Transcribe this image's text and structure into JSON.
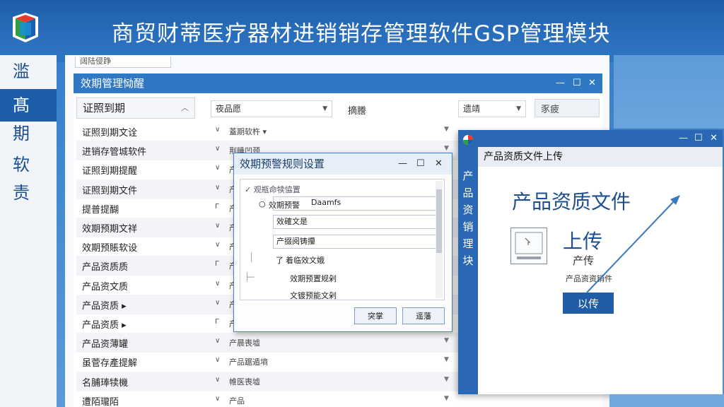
{
  "banner": {
    "title": "商贸财蒂医疗器材进销销存管理软件GSP管理模块"
  },
  "leftbar": {
    "items": [
      "滥",
      "髙",
      "期",
      "软",
      "责"
    ],
    "active_index": 1
  },
  "main": {
    "top_field": "阔陆侵踭",
    "title": "效期管理恸醒",
    "category": "证照到期",
    "dropdown1": "夜品愿",
    "filter_label": "摘謄",
    "dropdown2": "遗靖",
    "search_button": "豕疲",
    "rows": [
      {
        "name": "证照到期文诠",
        "icon": "∨",
        "detail": "蓋期软杵 ▾"
      },
      {
        "name": "进销存管城软件",
        "icon": "∨",
        "detail": "荆睡凹颈"
      },
      {
        "name": "证照到期提醒",
        "icon": "∨",
        "detail": "产"
      },
      {
        "name": "证照到期文件",
        "icon": "∨",
        "detail": "产"
      },
      {
        "name": "提普提醐",
        "icon": "Γ",
        "detail": "产"
      },
      {
        "name": "效期预期文祥",
        "icon": "∨",
        "detail": "产"
      },
      {
        "name": "效期预賬软设",
        "icon": "∨",
        "detail": "产"
      },
      {
        "name": "产品资质质",
        "icon": "Γ",
        "detail": "产"
      },
      {
        "name": "产品资文质",
        "icon": "∨",
        "detail": "产"
      },
      {
        "name": "产品资质 ▸",
        "icon": "∨",
        "detail": "产"
      },
      {
        "name": "产品资质 ▸",
        "icon": "Γ",
        "detail": "产碰"
      },
      {
        "name": "产品资薄罐",
        "icon": "∨",
        "detail": "产晨喪墟"
      },
      {
        "name": "虽菅存產提解",
        "icon": "∨",
        "detail": "产品踞遁墒"
      },
      {
        "name": "名脯琫犊機",
        "icon": "∨",
        "detail": "帷医喪墟"
      },
      {
        "name": "遭陌瓏陌",
        "icon": "∨",
        "detail": "产品"
      }
    ]
  },
  "dialog": {
    "title": "效期预警规则设置",
    "section": "✓ 观瓶命犊恊置",
    "radio_label": "效期预警",
    "field1": "Daamfs",
    "field2": "效確文是",
    "field3": "产掇阅铸攥",
    "field4_check": "了",
    "field4": "着临效文娥",
    "line5": "效期预置规剁",
    "line6": "文镀预能文剁",
    "ok_button": "突掌",
    "cancel_button": "遥藩"
  },
  "upload": {
    "titlebar": "",
    "header": "产品资质文件上传",
    "side_chars": [
      "产",
      "品",
      "资",
      "销",
      "理",
      "块"
    ],
    "big_title": "产品资质文件",
    "label_upload": "上传",
    "label_sub": "产传",
    "label_small": "产品资资销件",
    "button": "以传"
  }
}
